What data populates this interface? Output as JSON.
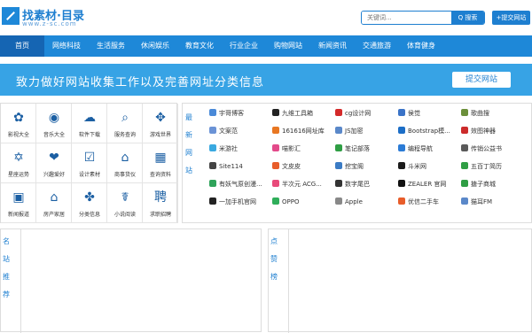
{
  "logo": {
    "title": "找素材·目录",
    "sub": "www.z-sc.com"
  },
  "search": {
    "placeholder": "关键词...",
    "button": "Q 搜索"
  },
  "header": {
    "submit": "+提交网站"
  },
  "nav": [
    "首页",
    "网络科技",
    "生活服务",
    "休闲娱乐",
    "教育文化",
    "行业企业",
    "购物网站",
    "新闻资讯",
    "交通旅游",
    "体育健身"
  ],
  "banner": {
    "text": "致力做好网站收集工作以及完善网址分类信息",
    "button": "提交网站"
  },
  "categories": [
    {
      "label": "影视大全",
      "icon": "film-reel-icon",
      "glyph": "✿"
    },
    {
      "label": "音乐大全",
      "icon": "music-disc-icon",
      "glyph": "◉"
    },
    {
      "label": "软件下载",
      "icon": "cloud-download-icon",
      "glyph": "☁"
    },
    {
      "label": "服务查询",
      "icon": "search-doc-icon",
      "glyph": "⌕"
    },
    {
      "label": "游戏世界",
      "icon": "gamepad-icon",
      "glyph": "✥"
    },
    {
      "label": "星座运势",
      "icon": "star-icon",
      "glyph": "✡"
    },
    {
      "label": "兴趣爱好",
      "icon": "heart-hands-icon",
      "glyph": "❤"
    },
    {
      "label": "设计素材",
      "icon": "checklist-icon",
      "glyph": "☑"
    },
    {
      "label": "商事货仪",
      "icon": "bank-icon",
      "glyph": "⌂"
    },
    {
      "label": "查询资料",
      "icon": "calendar-icon",
      "glyph": "▦"
    },
    {
      "label": "新闻报道",
      "icon": "chat-bubble-icon",
      "glyph": "▣"
    },
    {
      "label": "房产家居",
      "icon": "house-icon",
      "glyph": "⌂"
    },
    {
      "label": "分类信息",
      "icon": "clover-icon",
      "glyph": "✤"
    },
    {
      "label": "小说阅读",
      "icon": "caduceus-icon",
      "glyph": "☤"
    },
    {
      "label": "求职招聘",
      "icon": "hire-icon",
      "glyph": "聘"
    }
  ],
  "latest": {
    "title": "最新网站",
    "links": [
      {
        "label": "宇哥博客",
        "color": "#4a8ad8"
      },
      {
        "label": "九维工具箱",
        "color": "#222222"
      },
      {
        "label": "cg设计网",
        "color": "#d42a2a"
      },
      {
        "label": "侯觉",
        "color": "#3a73c7"
      },
      {
        "label": "歌曲搜",
        "color": "#6b8f3a"
      },
      {
        "label": "文案范",
        "color": "#6b93d6"
      },
      {
        "label": "161616网址库",
        "color": "#e87722"
      },
      {
        "label": "JS加密",
        "color": "#5a88c9"
      },
      {
        "label": "Bootstrap模...",
        "color": "#1c6ec7"
      },
      {
        "label": "效图神器",
        "color": "#cc2b2b"
      },
      {
        "label": "米游社",
        "color": "#3aa9e0"
      },
      {
        "label": "喵影汇",
        "color": "#e34a8a"
      },
      {
        "label": "笔记部落",
        "color": "#2f9e44"
      },
      {
        "label": "编程导航",
        "color": "#2b7bd6"
      },
      {
        "label": "传销公益书",
        "color": "#5a5a5a"
      },
      {
        "label": "Site114",
        "color": "#444444"
      },
      {
        "label": "文皮皮",
        "color": "#e85d2a"
      },
      {
        "label": "挖宝阁",
        "color": "#3b7bc4"
      },
      {
        "label": "斗米网",
        "color": "#1a1a1a"
      },
      {
        "label": "五百丁简历",
        "color": "#2f9e44"
      },
      {
        "label": "有妖气原创漫...",
        "color": "#2fa35a"
      },
      {
        "label": "半次元 ACG...",
        "color": "#e84a7a"
      },
      {
        "label": "数字尾巴",
        "color": "#333333"
      },
      {
        "label": "ZEALER 官网",
        "color": "#111111"
      },
      {
        "label": "搪子商城",
        "color": "#2f9e44"
      },
      {
        "label": "一加手机官网",
        "color": "#222222"
      },
      {
        "label": "OPPO",
        "color": "#2fae5a"
      },
      {
        "label": "Apple",
        "color": "#888888"
      },
      {
        "label": "优信二手车",
        "color": "#e85d2a"
      },
      {
        "label": "猫耳FM",
        "color": "#5a88c9"
      }
    ]
  },
  "box_left": {
    "title": "名站推荐"
  },
  "box_right": {
    "title": "点赞榜"
  }
}
